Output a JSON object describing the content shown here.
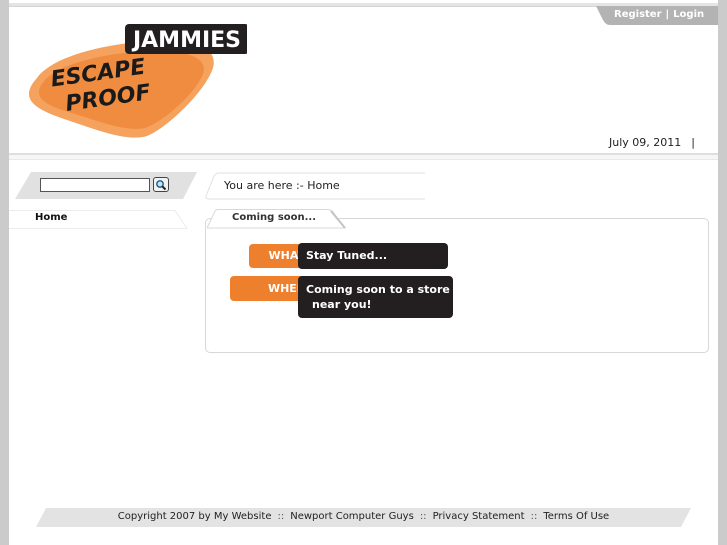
{
  "header": {
    "auth": {
      "register": "Register",
      "separator": "|",
      "login": "Login"
    },
    "logo": {
      "brand": "JAMMIES",
      "line1": "ESCAPE",
      "line2": "PROOF"
    },
    "date": "July 09, 2011",
    "date_separator": "|"
  },
  "sidebar": {
    "search": {
      "value": "",
      "placeholder": ""
    },
    "search_icon": "magnifier-icon",
    "nav": [
      {
        "label": "Home"
      }
    ]
  },
  "breadcrumb": {
    "text": "You are here :- Home"
  },
  "content": {
    "tab_title": "Coming soon...",
    "rows": [
      {
        "label": "WHAT",
        "value_line1": "Stay Tuned...",
        "value_line2": ""
      },
      {
        "label": "WHEN",
        "value_line1": "Coming soon to a store",
        "value_line2": "near you!"
      }
    ]
  },
  "footer": {
    "copyright": "Copyright 2007 by My Website",
    "links": [
      "Newport Computer Guys",
      "Privacy Statement",
      "Terms Of Use"
    ],
    "separator": "::"
  },
  "colors": {
    "accent_orange": "#ee7f2d",
    "logo_orange": "#f4a25e",
    "dark": "#231f20",
    "tab_gray": "#b5b5b5",
    "bar_gray": "#e3e3e3"
  }
}
